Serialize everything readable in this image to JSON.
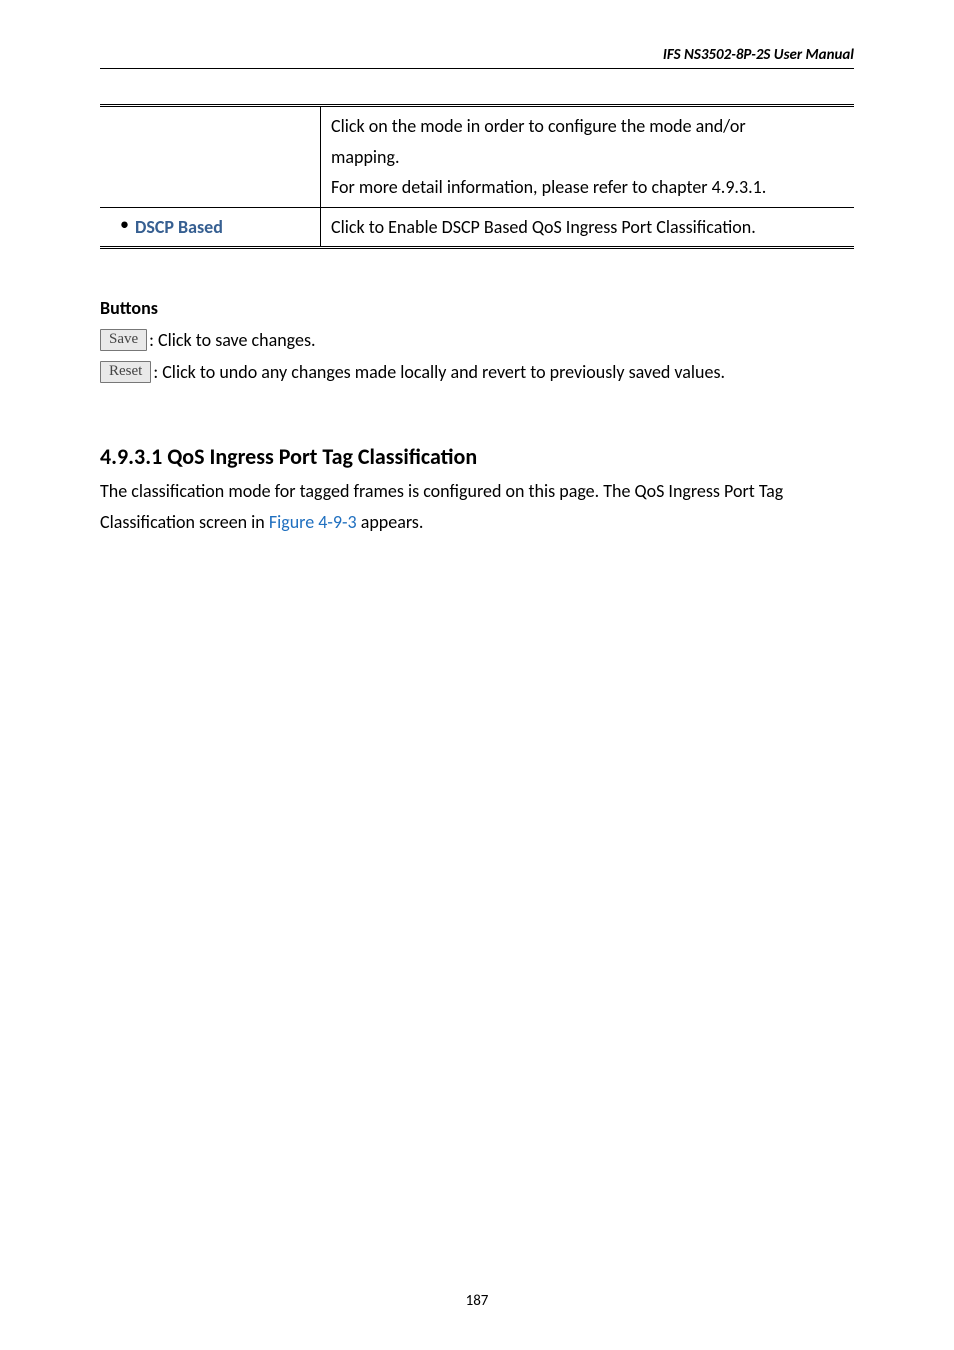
{
  "header": {
    "title": "IFS  NS3502-8P-2S  User  Manual"
  },
  "table": {
    "row1": {
      "line1": "Click on the mode in order to configure the mode and/or",
      "line2": "mapping.",
      "line3": "For more detail information, please refer to chapter 4.9.3.1."
    },
    "row2": {
      "label": "DSCP Based",
      "desc": "Click to Enable DSCP Based QoS Ingress Port Classification."
    }
  },
  "buttons_section": {
    "heading": "Buttons",
    "save": {
      "label": "Save",
      "text": ": Click to save changes."
    },
    "reset": {
      "label": "Reset",
      "text": ": Click to undo any changes made locally and revert to previously saved values."
    }
  },
  "subsection": {
    "heading": "4.9.3.1 QoS Ingress Port Tag Classification",
    "para_part1": "The classification mode for tagged frames is configured on this page. The QoS Ingress Port Tag",
    "para_part2a": "Classification screen in ",
    "para_link": "Figure 4-9-3",
    "para_part2b": " appears."
  },
  "footer": {
    "page_number": "187"
  }
}
